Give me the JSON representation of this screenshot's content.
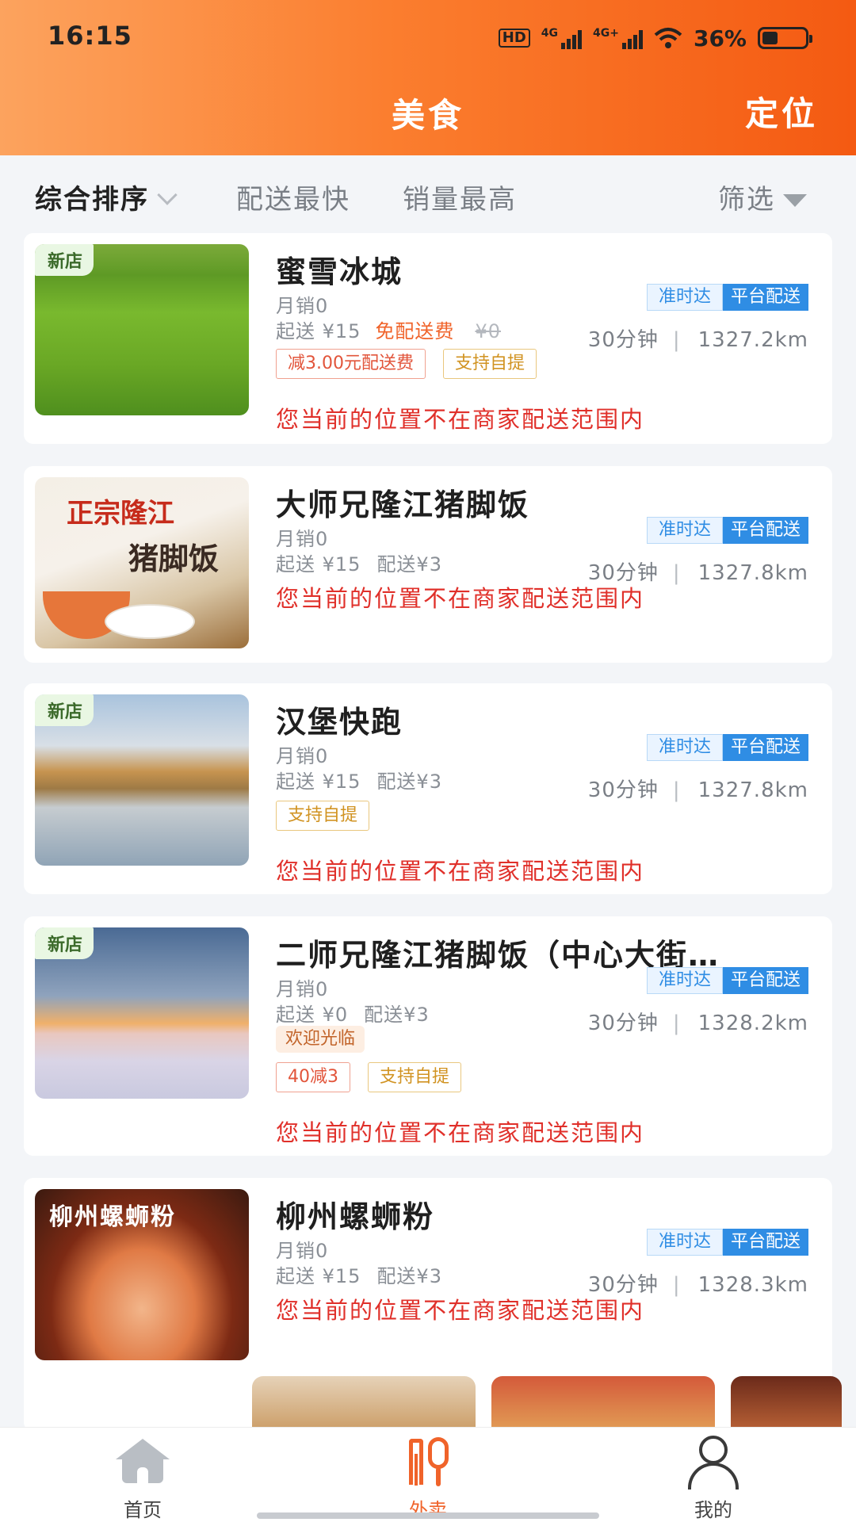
{
  "status_bar": {
    "time": "16:15",
    "hd": "HD",
    "sig1": "4G",
    "sig2": "4G+",
    "battery": "36%",
    "battery_level": 0.36
  },
  "header": {
    "title": "美食",
    "locate": "定位"
  },
  "sort": {
    "comprehensive": "综合排序",
    "fastest": "配送最快",
    "top_sales": "销量最高",
    "filter": "筛选"
  },
  "common": {
    "ontime": "准时达",
    "platform": "平台配送",
    "out_of_range": "您当前的位置不在商家配送范围内",
    "new_tag": "新店"
  },
  "stores": [
    {
      "name": "蜜雪冰城",
      "monthly": "月销0",
      "min": "起送 ¥15",
      "free": "免配送费",
      "strike": "¥0",
      "time": "30分钟",
      "distance": "1327.2km",
      "tag1": "减3.00元配送费",
      "tag2": "支持自提"
    },
    {
      "name": "大师兄隆江猪脚饭",
      "monthly": "月销0",
      "min": "起送 ¥15",
      "fee": "配送¥3",
      "time": "30分钟",
      "distance": "1327.8km",
      "img_t1": "正宗隆江",
      "img_t2": "猪脚饭"
    },
    {
      "name": "汉堡快跑",
      "monthly": "月销0",
      "min": "起送 ¥15",
      "fee": "配送¥3",
      "time": "30分钟",
      "distance": "1327.8km",
      "tag1": "支持自提"
    },
    {
      "name": "二师兄隆江猪脚饭（中心大街…",
      "monthly": "月销0",
      "min": "起送 ¥0",
      "fee": "配送¥3",
      "time": "30分钟",
      "distance": "1328.2km",
      "welcome": "欢迎光临",
      "tag1": "40减3",
      "tag2": "支持自提"
    },
    {
      "name": "柳州螺蛳粉",
      "monthly": "月销0",
      "min": "起送 ¥15",
      "fee": "配送¥3",
      "time": "30分钟",
      "distance": "1328.3km",
      "img_t1": "柳州螺蛳粉"
    }
  ],
  "nav": {
    "home": "首页",
    "takeout": "外卖",
    "mine": "我的"
  }
}
